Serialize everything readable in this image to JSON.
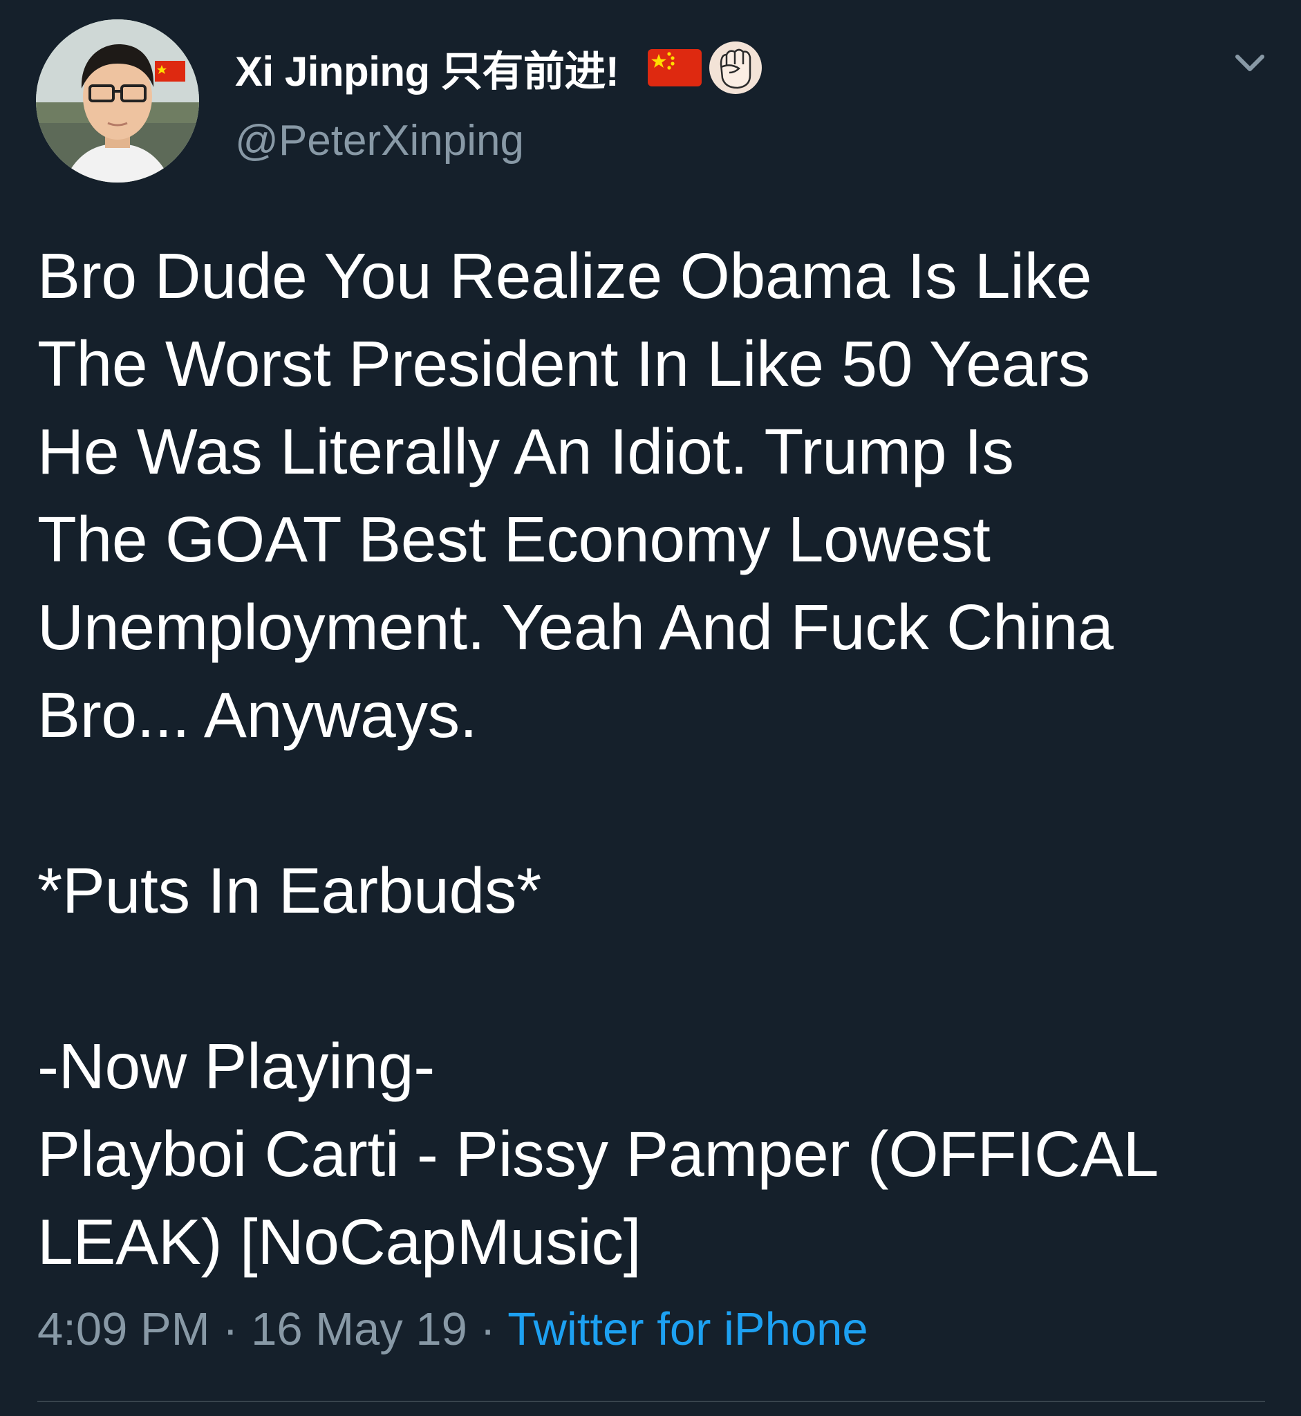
{
  "tweet": {
    "author": {
      "display_name": "Xi Jinping 只有前进!",
      "handle": "@PeterXinping",
      "name_emojis": [
        "china-flag-icon",
        "raised-fist-icon"
      ]
    },
    "text_lines": [
      "Bro Dude You Realize Obama Is Like",
      "The Worst President In Like 50 Years",
      "He Was Literally An Idiot. Trump Is",
      "The GOAT Best Economy Lowest",
      "Unemployment. Yeah And Fuck China",
      "Bro... Anyways.",
      "",
      "*Puts In Earbuds*",
      "",
      "-Now Playing-",
      "Playboi Carti - Pissy Pamper (OFFICAL",
      "LEAK) [NoCapMusic]"
    ],
    "meta": {
      "time": "4:09 PM",
      "separator": " · ",
      "date": "16 May 19",
      "source": "Twitter for iPhone"
    }
  },
  "colors": {
    "background": "#15202b",
    "text": "#ffffff",
    "secondary_text": "#8899a6",
    "link": "#1da1f2",
    "divider": "#38444d"
  }
}
